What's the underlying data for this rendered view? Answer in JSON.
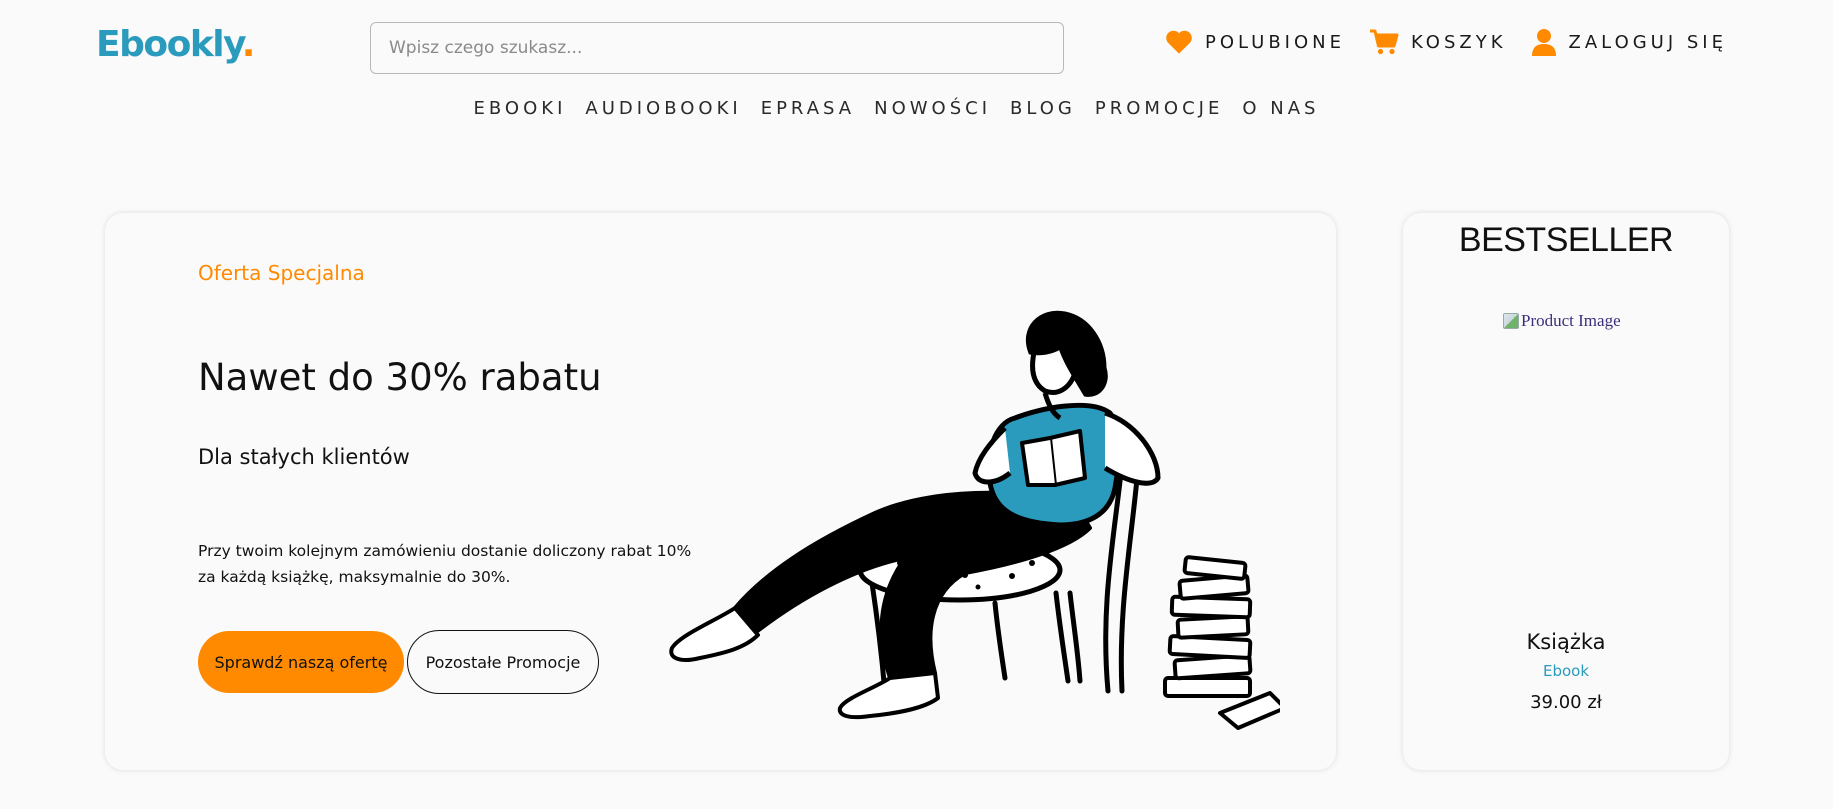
{
  "header": {
    "logo_text": "Ebookly",
    "logo_dot": ".",
    "search_placeholder": "Wpisz czego szukasz...",
    "actions": [
      {
        "icon": "heart-icon",
        "label": "POLUBIONE"
      },
      {
        "icon": "cart-icon",
        "label": "KOSZYK"
      },
      {
        "icon": "user-icon",
        "label": "ZALOGUJ SIĘ"
      }
    ]
  },
  "nav": [
    "EBOOKI",
    "AUDIOBOOKI",
    "EPRASA",
    "NOWOŚCI",
    "BLOG",
    "PROMOCJE",
    "O NAS"
  ],
  "promo": {
    "eyebrow": "Oferta Specjalna",
    "title": "Nawet do 30% rabatu",
    "subtitle": "Dla stałych klientów",
    "description": "Przy twoim kolejnym zamówieniu dostanie doliczony rabat 10% za każdą książkę, maksymalnie do 30%.",
    "primary_button": "Sprawdź naszą ofertę",
    "secondary_button": "Pozostałe Promocje",
    "illustration": "person-reading-illustration"
  },
  "bestseller": {
    "heading": "BESTSELLER",
    "image_alt": "Product Image",
    "title": "Książka",
    "type": "Ebook",
    "price": "39.00 zł"
  },
  "colors": {
    "accent_orange": "#ff8a00",
    "brand_teal": "#2a9bbd",
    "shirt_teal": "#2a9bbd",
    "background": "#fafafa"
  }
}
